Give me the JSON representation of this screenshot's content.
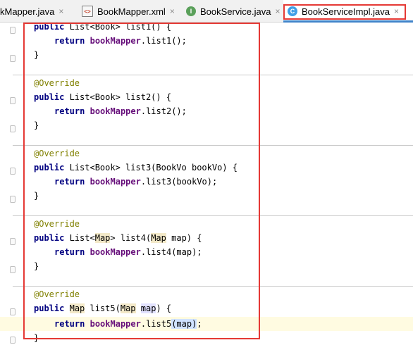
{
  "tabs": [
    {
      "label": "kMapper.java",
      "icon": "java-file-icon"
    },
    {
      "label": "BookMapper.xml",
      "icon": "xml-file-icon"
    },
    {
      "label": "BookService.java",
      "icon": "interface-icon"
    },
    {
      "label": "BookServiceImpl.java",
      "icon": "class-icon"
    }
  ],
  "icons": {
    "close": "×",
    "xml": "<>",
    "interface": "I",
    "class": "C"
  },
  "colors": {
    "keyword": "#000080",
    "annotation": "#808000",
    "field": "#660e7a",
    "highlight_box": "#e53935",
    "active_tab_underline": "#4083c9"
  },
  "code": {
    "kw_public": "public",
    "kw_return": "return",
    "override": "@Override",
    "field": "bookMapper",
    "lines": {
      "l1_sig": " List<Book> list1() {",
      "l1_ret": ".list1();",
      "l2_sig": " List<Book> list2() {",
      "l2_ret": ".list2();",
      "l3_sig": " List<Book> list3(BookVo bookVo) {",
      "l3_ret": ".list3(bookVo);",
      "l4_a": " List<",
      "l4_map": "Map",
      "l4_b": "> list4(",
      "l4_map2": "Map",
      "l4_c": " map) {",
      "l4_ret": ".list4(map);",
      "l5_map": "Map",
      "l5_a": " list5(",
      "l5_map2": "Map",
      "l5_sp": " ",
      "l5_map3": "map",
      "l5_b": ") {",
      "l5_ret_a": ".list5",
      "l5_ret_sel": "(map)",
      "l5_ret_end": ";",
      "brace": "}"
    }
  }
}
